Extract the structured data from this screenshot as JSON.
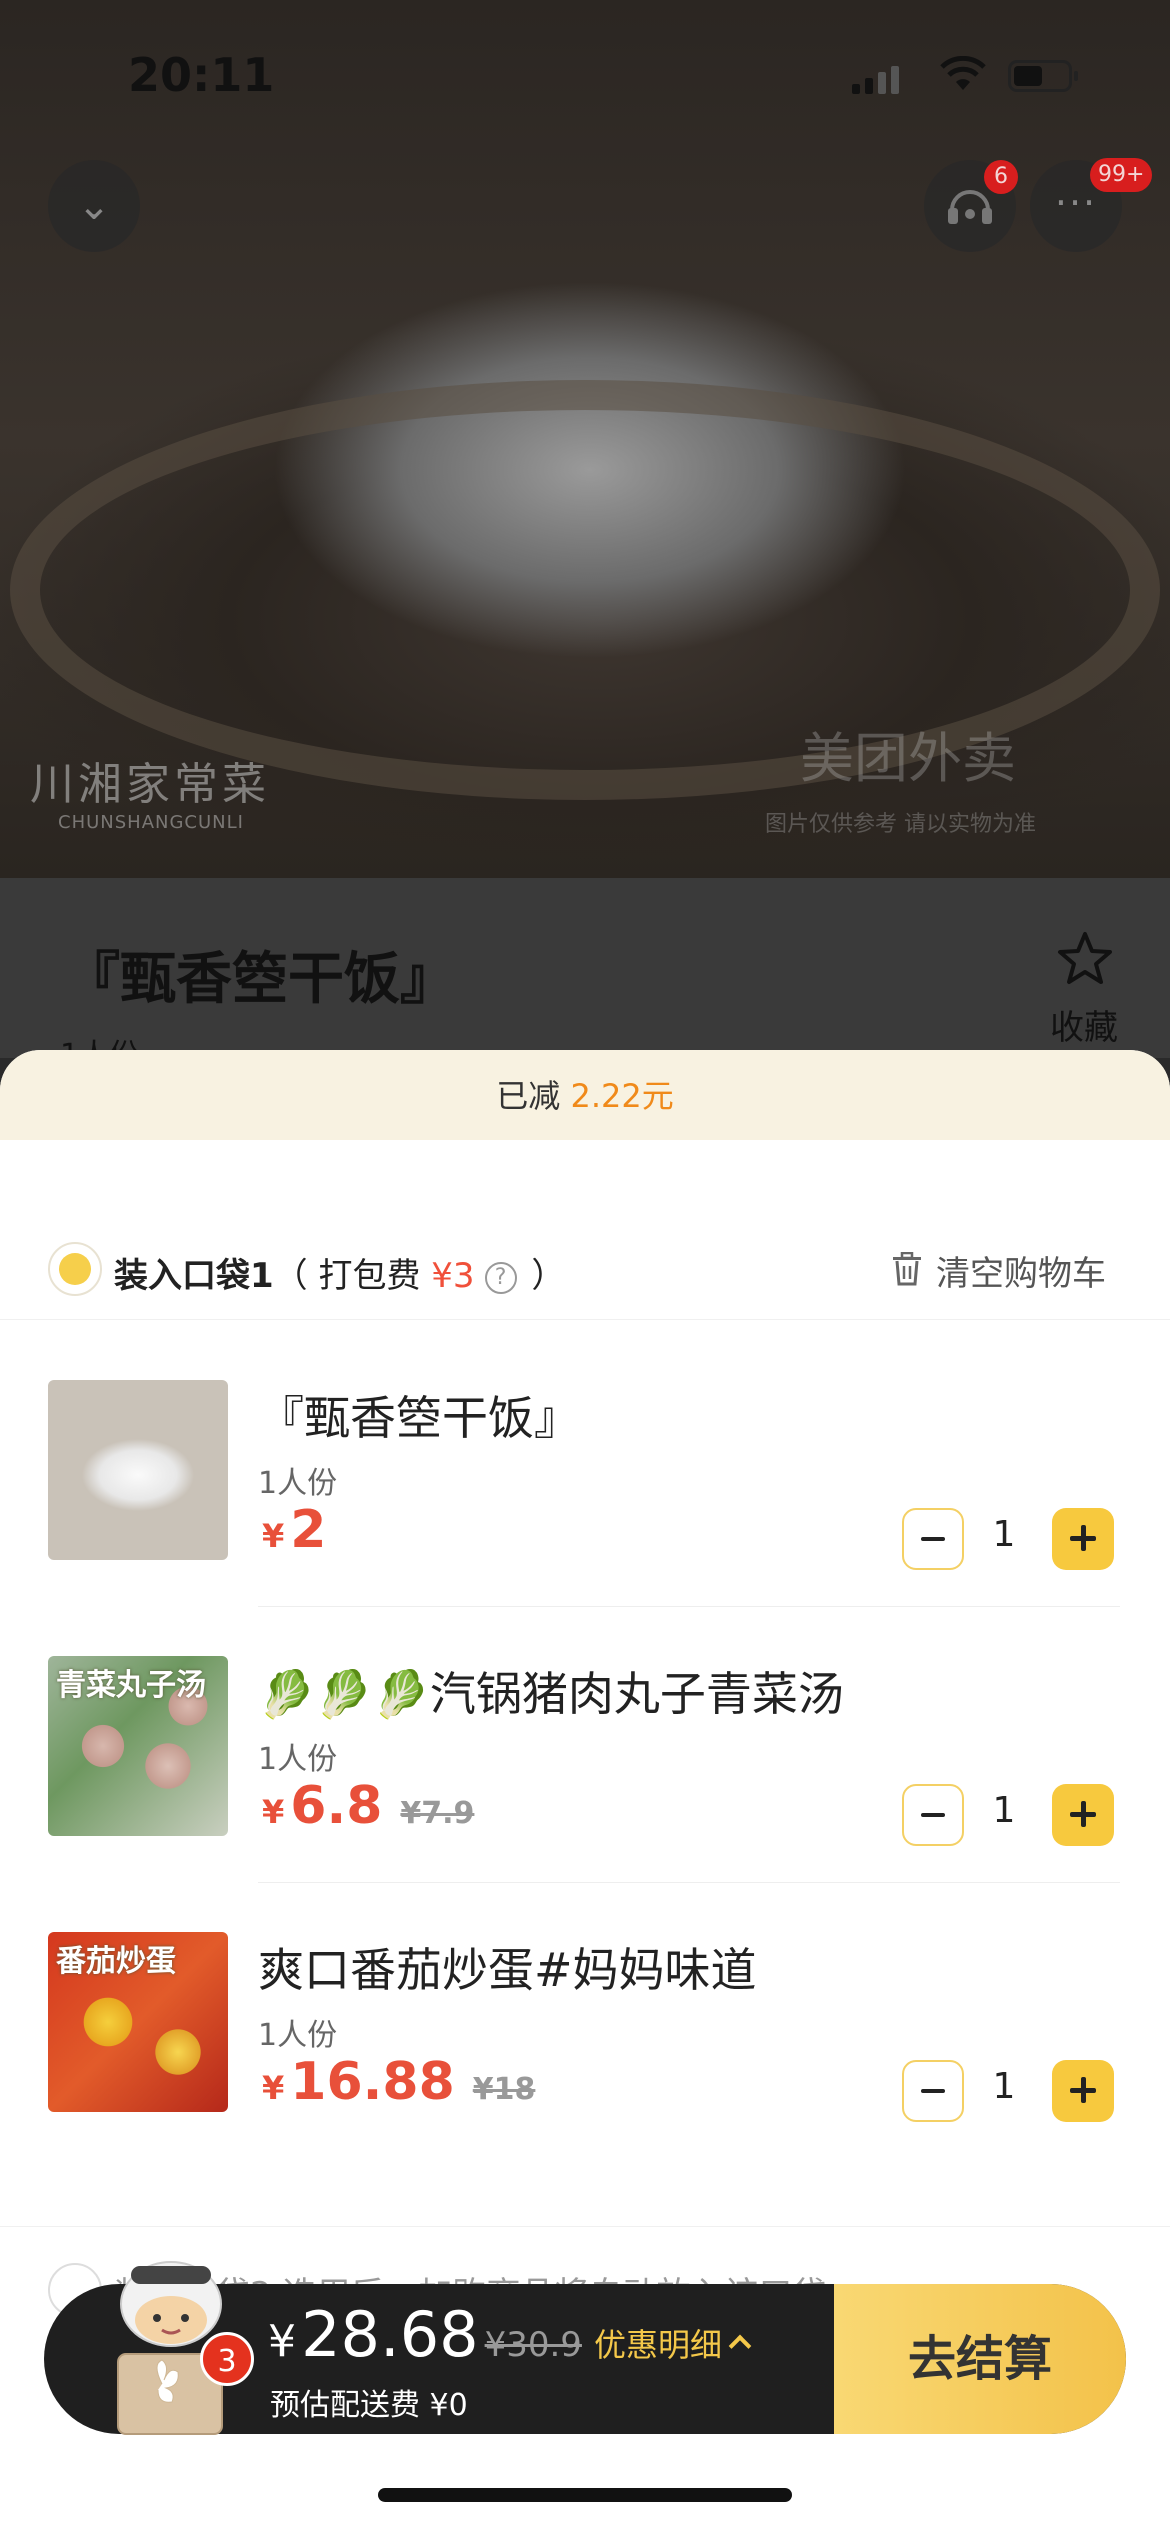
{
  "status": {
    "time": "20:11"
  },
  "header": {
    "service_badge": "6",
    "more_badge": "99+",
    "more_glyph": "···",
    "back_glyph": "⌄"
  },
  "hero": {
    "watermark_left": "川湘家常菜",
    "watermark_left_sub": "CHUNSHANGCUNLI",
    "watermark_right": "美团外卖",
    "watermark_right_sub": "图片仅供参考 请以实物为准"
  },
  "dish": {
    "title": "『甄香箜干饭』",
    "subtitle": "1人份",
    "favorite_label": "收藏"
  },
  "cart": {
    "discount_prefix": "已减",
    "discount_amount": "2.22元",
    "pocket1": {
      "label": "装入口袋1",
      "fee_prefix": "（ 打包费 ",
      "fee": "¥3",
      "fee_suffix": " ）",
      "help_glyph": "?"
    },
    "clear_label": "清空购物车",
    "items": [
      {
        "name": "『甄香箜干饭』",
        "portion": "1人份",
        "yen": "¥",
        "price": "2",
        "original": "",
        "qty": "1",
        "img_caption": ""
      },
      {
        "name": "🥬🥬🥬汽锅猪肉丸子青菜汤",
        "portion": "1人份",
        "yen": "¥",
        "price": "6.8",
        "original": "¥7.9",
        "qty": "1",
        "img_caption": "青菜丸子汤"
      },
      {
        "name": "爽口番茄炒蛋#妈妈味道",
        "portion": "1人份",
        "yen": "¥",
        "price": "16.88",
        "original": "¥18",
        "qty": "1",
        "img_caption": "番茄炒蛋"
      }
    ],
    "pocket2_text": "装入口袋2 选用后，加购商品将自动放入该口袋"
  },
  "checkout": {
    "yen": "¥",
    "total": "28.68",
    "original_total": "¥30.9",
    "promo_detail": "优惠明细",
    "delivery": "预估配送费 ¥0",
    "button": "去结算",
    "cart_count": "3"
  },
  "colors": {
    "accent_yellow": "#F7C93E",
    "price_red": "#E8503A",
    "discount_orange": "#F08A1A"
  },
  "icons": [
    "chevron-down-icon",
    "customer-service-icon",
    "more-icon",
    "star-icon",
    "help-icon",
    "trash-icon",
    "minus-icon",
    "plus-icon",
    "chevron-up-icon"
  ]
}
